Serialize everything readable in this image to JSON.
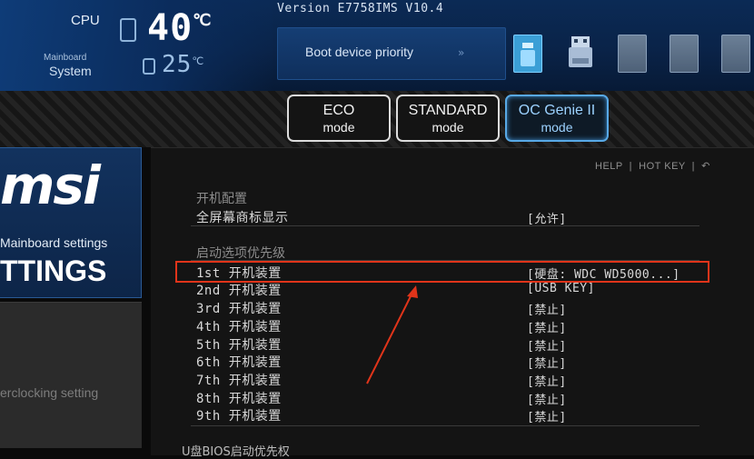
{
  "header": {
    "cpu_label": "CPU",
    "mainboard_label": "Mainboard",
    "system_label": "System",
    "cpu_temp": "40",
    "system_temp": "25",
    "temp_unit": "℃",
    "version": "Version E7758IMS V10.4",
    "boot_priority_label": "Boot device priority",
    "boot_arrows": "»"
  },
  "modes": {
    "eco": {
      "line1": "ECO",
      "line2": "mode"
    },
    "standard": {
      "line1": "STANDARD",
      "line2": "mode"
    },
    "oc": {
      "line1": "OC Genie II",
      "line2": "mode"
    }
  },
  "left": {
    "logo": "msi",
    "mainboard_settings": "Mainboard settings",
    "settings": "TTINGS",
    "overclocking": "erclocking setting"
  },
  "help": {
    "help": "HELP",
    "divider": "|",
    "hotkey": "HOT KEY",
    "back": "↶"
  },
  "settings": {
    "section1": "开机配置",
    "fullscreen_logo": {
      "label": "全屏幕商标显示",
      "value": "[允许]"
    },
    "section2": "启动选项优先级",
    "boot_devices": [
      {
        "label": "1st 开机装置",
        "value": "[硬盘: WDC WD5000...]"
      },
      {
        "label": "2nd 开机装置",
        "value": "[USB KEY]"
      },
      {
        "label": "3rd 开机装置",
        "value": "[禁止]"
      },
      {
        "label": "4th 开机装置",
        "value": "[禁止]"
      },
      {
        "label": "5th 开机装置",
        "value": "[禁止]"
      },
      {
        "label": "6th 开机装置",
        "value": "[禁止]"
      },
      {
        "label": "7th 开机装置",
        "value": "[禁止]"
      },
      {
        "label": "8th 开机装置",
        "value": "[禁止]"
      },
      {
        "label": "9th 开机装置",
        "value": "[禁止]"
      }
    ],
    "bottom_item": "U盘BIOS启动优先权"
  },
  "colors": {
    "highlight": "#e0341a",
    "accent_blue": "#3b9fd6"
  }
}
